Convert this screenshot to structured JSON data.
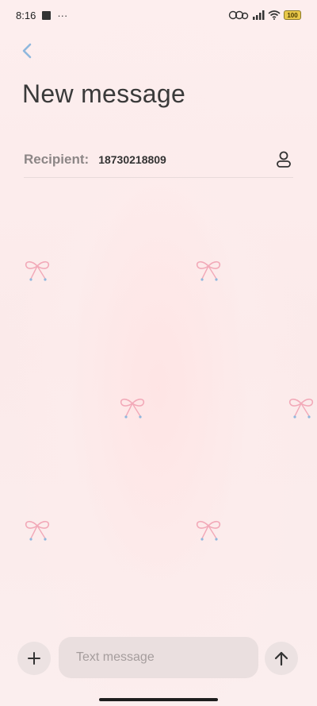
{
  "status_bar": {
    "time": "8:16",
    "dots": "···",
    "battery": "100"
  },
  "header": {
    "back_icon": "chevron-left-icon",
    "title": "New message"
  },
  "recipient": {
    "label": "Recipient:",
    "value": "18730218809",
    "contact_icon": "person-icon"
  },
  "composer": {
    "add_icon": "plus-icon",
    "placeholder": "Text message",
    "value": "",
    "send_icon": "arrow-up-icon"
  },
  "colors": {
    "background": "#fbecec",
    "accent_blue": "#8fb8de",
    "bow_pink": "#f2a9b8",
    "input_bg": "#eadfdf"
  }
}
